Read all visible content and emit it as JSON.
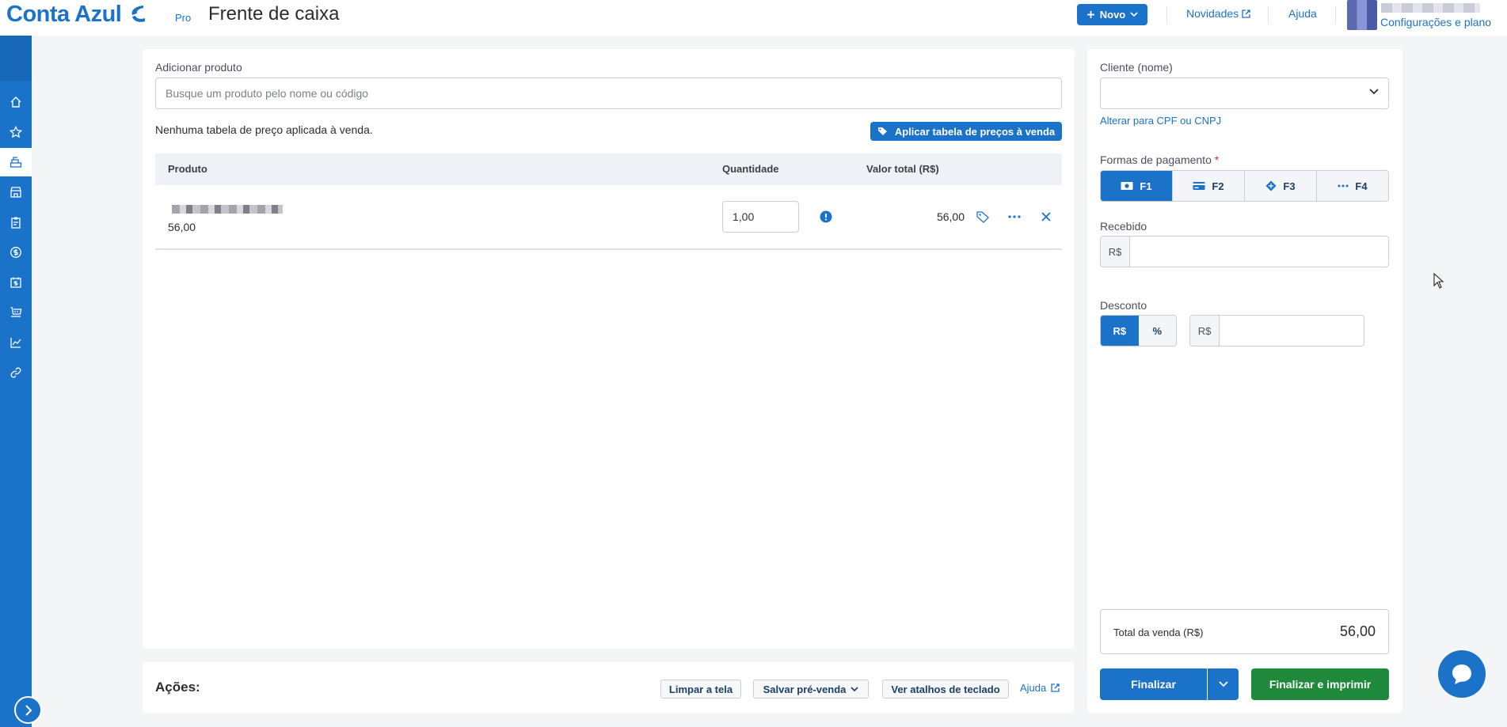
{
  "header": {
    "logo_text": "Conta Azul",
    "logo_badge": "Pro",
    "page_title": "Frente de caixa",
    "new_button": "Novo",
    "news_link": "Novidades",
    "help_link": "Ajuda",
    "config_link": "Configurações e plano"
  },
  "sidebar": {
    "items": [
      "home-icon",
      "star-icon",
      "cash-register-icon",
      "store-icon",
      "clipboard-icon",
      "dollar-icon",
      "calendar-money-icon",
      "cart-icon",
      "chart-line-icon",
      "link-icon"
    ],
    "active": "cash-register-icon"
  },
  "product": {
    "add_label": "Adicionar produto",
    "search_placeholder": "Busque um produto pelo nome ou código",
    "no_price_table": "Nenhuma tabela de preço aplicada à venda.",
    "apply_price_table_button": "Aplicar tabela de preços à venda"
  },
  "table": {
    "columns": [
      "Produto",
      "Quantidade",
      "Valor total (R$)"
    ],
    "rows": [
      {
        "unit_price": "56,00",
        "quantity": "1,00",
        "total": "56,00"
      }
    ]
  },
  "actions": {
    "label": "Ações:",
    "clear": "Limpar a tela",
    "save_presale": "Salvar pré-venda",
    "shortcuts": "Ver atalhos de teclado",
    "help": "Ajuda"
  },
  "sidebar_panel": {
    "client_label": "Cliente (nome)",
    "alt_link": "Alterar para CPF ou CNPJ",
    "payment_label": "Formas de pagamento",
    "required_mark": "*",
    "payment_options": [
      "F1",
      "F2",
      "F3",
      "F4"
    ],
    "received_label": "Recebido",
    "currency_prefix": "R$",
    "discount_label": "Desconto",
    "discount_options": [
      "R$",
      "%"
    ],
    "total_label": "Total da venda (R$)",
    "total_value": "56,00",
    "finalize": "Finalizar",
    "finalize_print": "Finalizar e imprimir"
  },
  "colors": {
    "primary": "#1a73c8",
    "success": "#1f8a3b",
    "background": "#f4f5f7"
  }
}
